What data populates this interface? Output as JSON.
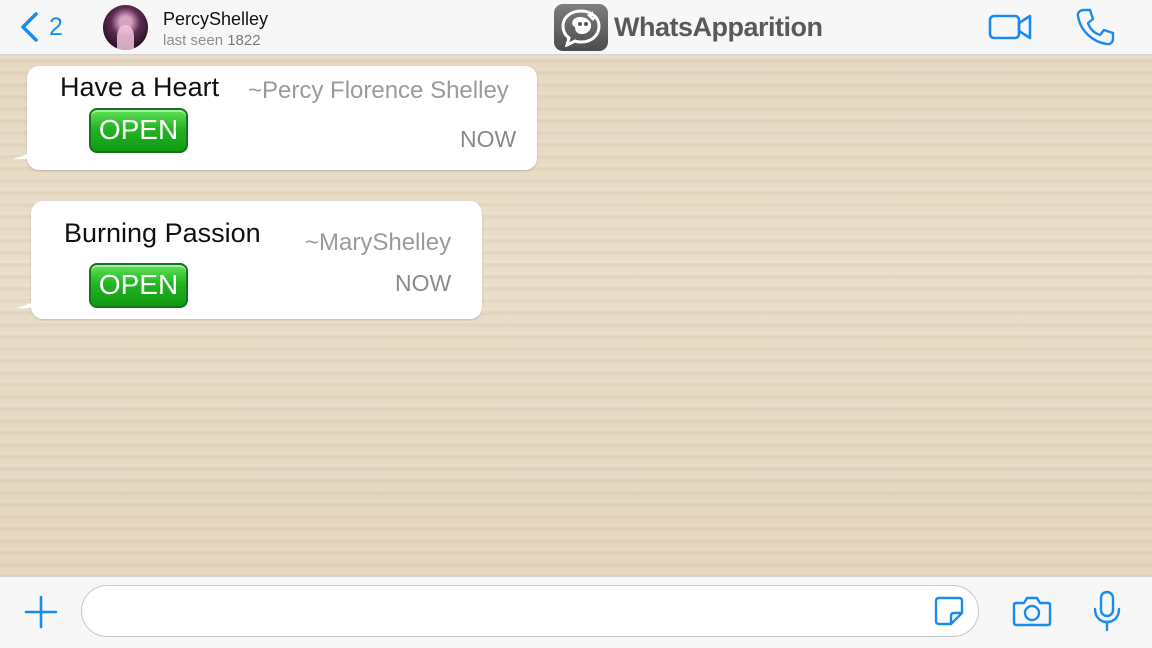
{
  "header": {
    "back_count": "2",
    "contact_name": "PercyShelley",
    "status_prefix": "last seen",
    "status_value": "1822",
    "brand_name": "WhatsApparition"
  },
  "messages": [
    {
      "title": "Have a Heart",
      "author": "~Percy Florence Shelley",
      "button_label": "OPEN",
      "time": "NOW"
    },
    {
      "title": "Burning Passion",
      "author": "~MaryShelley",
      "button_label": "OPEN",
      "time": "NOW"
    }
  ],
  "composer": {
    "input_value": "",
    "placeholder": ""
  },
  "icons": {
    "back": "chevron-left-icon",
    "video": "video-camera-icon",
    "phone": "phone-icon",
    "plus": "plus-icon",
    "sticker": "sticker-icon",
    "camera": "camera-icon",
    "mic": "microphone-icon"
  },
  "colors": {
    "accent": "#1a8cf0",
    "open_button": "#25b424",
    "chat_background": "#e6d9c3"
  }
}
